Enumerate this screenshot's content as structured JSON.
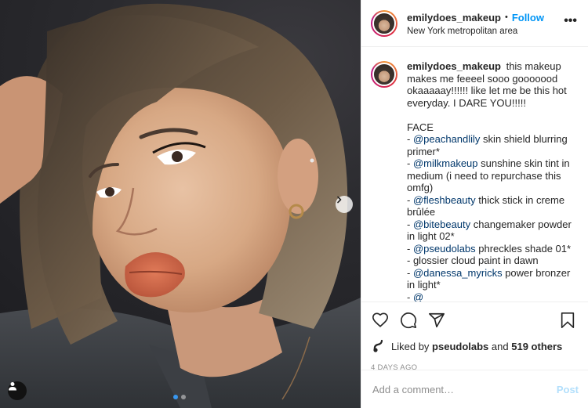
{
  "post": {
    "username": "emilydoes_makeup",
    "separator": "•",
    "follow_label": "Follow",
    "location": "New York metropolitan area",
    "more_label": "•••",
    "caption_intro": "this makeup makes me feeeel sooo gooooood okaaaaay!!!!!! like let me be this hot everyday. I DARE YOU!!!!!",
    "caption_section": "FACE",
    "caption_items": [
      {
        "prefix": "- ",
        "mention": "@peachandlily",
        "text": " skin shield blurring primer*"
      },
      {
        "prefix": "- ",
        "mention": "@milkmakeup",
        "text": " sunshine skin tint in medium (i need to repurchase this omfg)"
      },
      {
        "prefix": "- ",
        "mention": "@fleshbeauty",
        "text": " thick stick in creme brûlée"
      },
      {
        "prefix": "- ",
        "mention": "@bitebeauty",
        "text": " changemaker powder in light 02*"
      },
      {
        "prefix": "- ",
        "mention": "@pseudolabs",
        "text": " phreckles shade 01*"
      },
      {
        "prefix": "- ",
        "mention": "",
        "text": "glossier cloud paint in dawn"
      },
      {
        "prefix": "- ",
        "mention": "@danessa_myricks",
        "text": " power bronzer in light*"
      },
      {
        "prefix": "- ",
        "mention": "@_____",
        "text": " ____ ____ __ ___ _ ____ *"
      }
    ],
    "likes_prefix": "Liked by",
    "liked_by_user": "pseudolabs",
    "likes_and": "and",
    "likes_others": "519 others",
    "timestamp": "4 DAYS AGO",
    "comment_placeholder": "Add a comment…",
    "post_button": "Post"
  },
  "carousel": {
    "total": 2,
    "active_index": 0
  },
  "icons": {
    "like": "heart-icon",
    "comment": "comment-icon",
    "share": "share-icon",
    "save": "bookmark-icon",
    "next": "chevron-right-icon",
    "tags": "user-tag-icon"
  },
  "colors": {
    "follow": "#0095f6",
    "mention": "#00376b",
    "post_disabled": "#b2dffc",
    "muted": "#8e8e8e",
    "carousel_active": "#3897f0"
  }
}
